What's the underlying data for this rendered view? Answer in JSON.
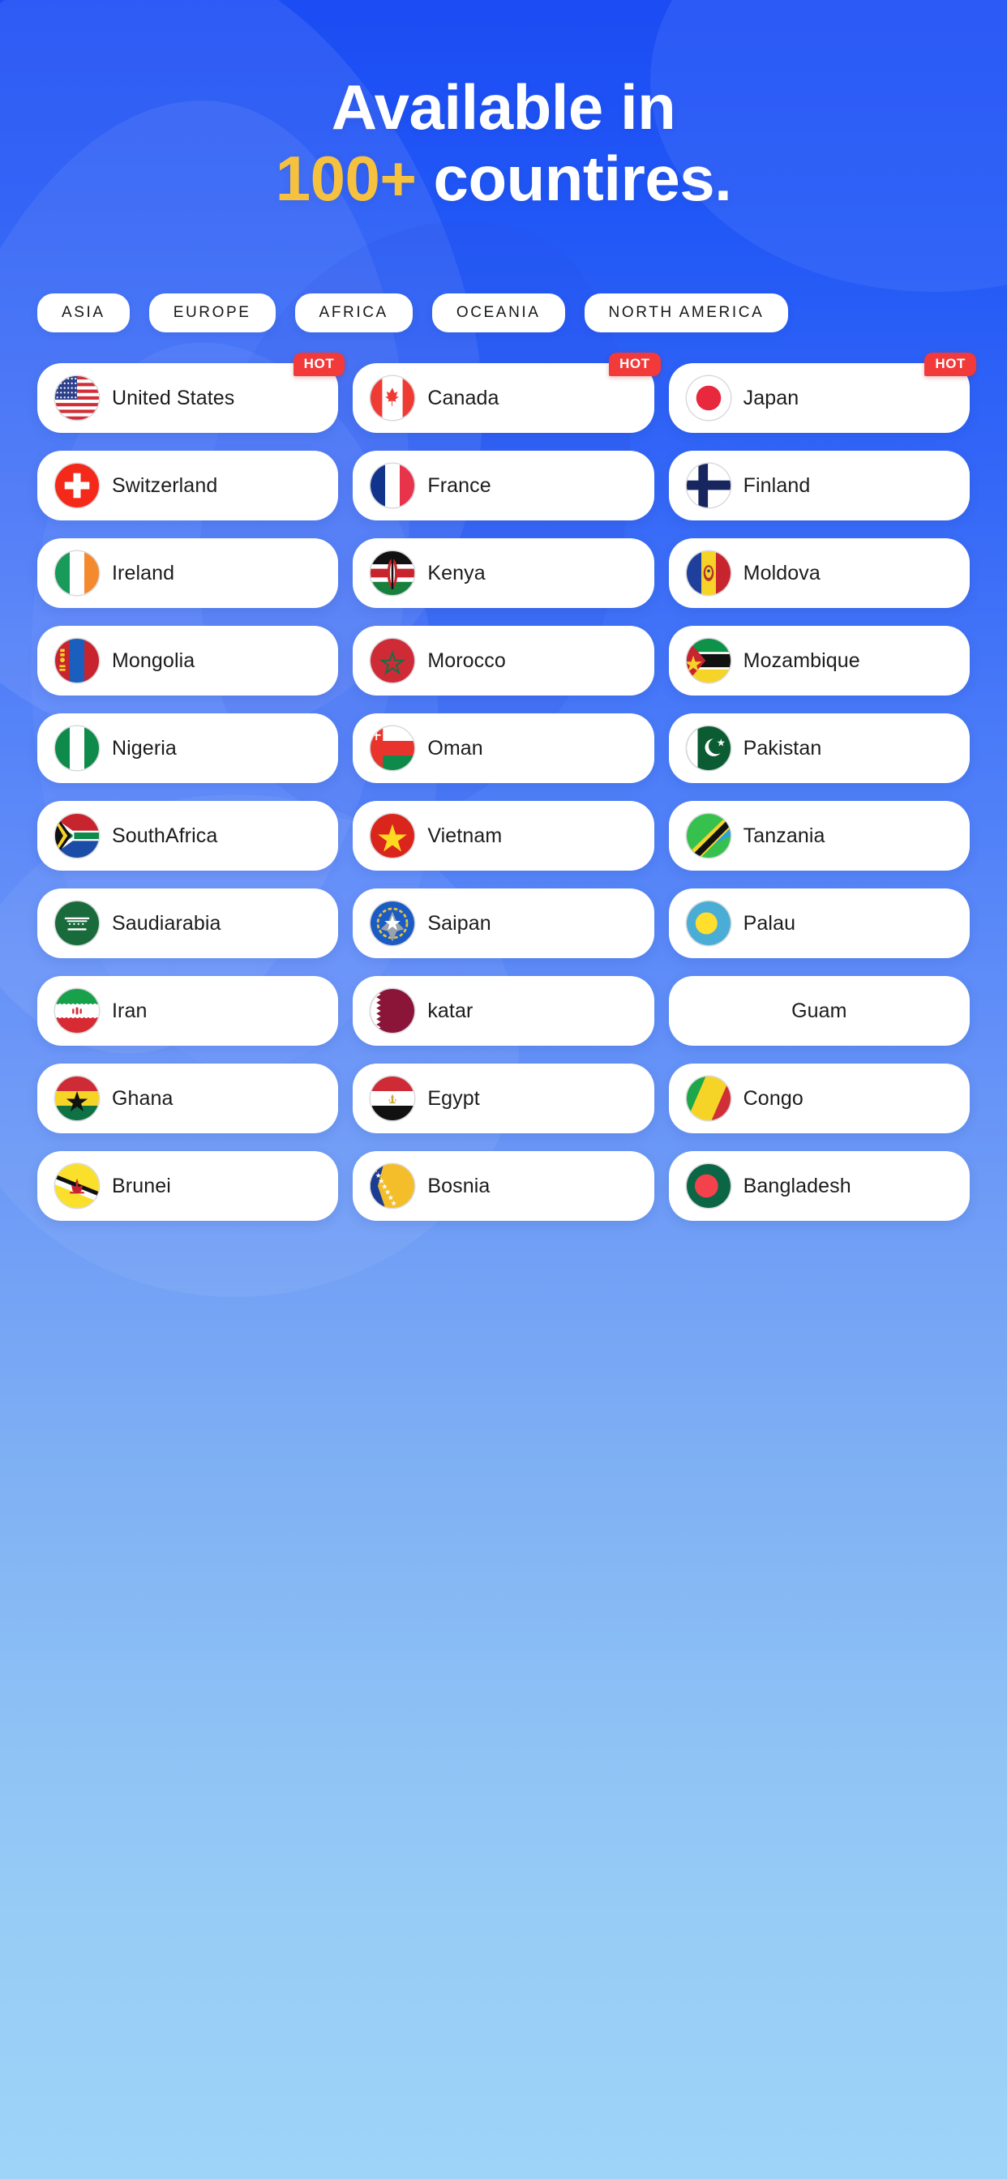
{
  "heading": {
    "line1": "Available in",
    "highlight": "100+",
    "line2_rest": " countires."
  },
  "colors": {
    "bg_top": "#1B4CF4",
    "bg_bottom": "#9ED4F8",
    "accent_yellow": "#F5C13F",
    "badge_red": "#F23A3A",
    "card_bg": "#FFFFFF",
    "text_dark": "#1C1C1C"
  },
  "tabs": [
    {
      "label": "ASIA"
    },
    {
      "label": "EUROPE"
    },
    {
      "label": "AFRICA"
    },
    {
      "label": "OCEANIA"
    },
    {
      "label": "NORTH AMERICA"
    }
  ],
  "badge_label": "HOT",
  "countries": [
    {
      "name": "United States",
      "flag": "flag-united-states",
      "badge": "HOT"
    },
    {
      "name": "Canada",
      "flag": "flag-canada",
      "badge": "HOT"
    },
    {
      "name": "Japan",
      "flag": "flag-japan",
      "badge": "HOT"
    },
    {
      "name": "Switzerland",
      "flag": "flag-switzerland",
      "badge": null
    },
    {
      "name": "France",
      "flag": "flag-france",
      "badge": null
    },
    {
      "name": "Finland",
      "flag": "flag-finland",
      "badge": null
    },
    {
      "name": "Ireland",
      "flag": "flag-ireland",
      "badge": null
    },
    {
      "name": "Kenya",
      "flag": "flag-kenya",
      "badge": null
    },
    {
      "name": "Moldova",
      "flag": "flag-moldova",
      "badge": null
    },
    {
      "name": "Mongolia",
      "flag": "flag-mongolia",
      "badge": null
    },
    {
      "name": "Morocco",
      "flag": "flag-morocco",
      "badge": null
    },
    {
      "name": "Mozambique",
      "flag": "flag-mozambique",
      "badge": null
    },
    {
      "name": "Nigeria",
      "flag": "flag-nigeria",
      "badge": null
    },
    {
      "name": "Oman",
      "flag": "flag-oman",
      "badge": null
    },
    {
      "name": "Pakistan",
      "flag": "flag-pakistan",
      "badge": null
    },
    {
      "name": "SouthAfrica",
      "flag": "flag-south-africa",
      "badge": null
    },
    {
      "name": "Vietnam",
      "flag": "flag-vietnam",
      "badge": null
    },
    {
      "name": "Tanzania",
      "flag": "flag-tanzania",
      "badge": null
    },
    {
      "name": "Saudiarabia",
      "flag": "flag-saudi-arabia",
      "badge": null
    },
    {
      "name": "Saipan",
      "flag": "flag-saipan",
      "badge": null
    },
    {
      "name": "Palau",
      "flag": "flag-palau",
      "badge": null
    },
    {
      "name": "Iran",
      "flag": "flag-iran",
      "badge": null
    },
    {
      "name": "katar",
      "flag": "flag-qatar",
      "badge": null
    },
    {
      "name": "Guam",
      "flag": null,
      "badge": null
    },
    {
      "name": "Ghana",
      "flag": "flag-ghana",
      "badge": null
    },
    {
      "name": "Egypt",
      "flag": "flag-egypt",
      "badge": null
    },
    {
      "name": "Congo",
      "flag": "flag-congo",
      "badge": null
    },
    {
      "name": "Brunei",
      "flag": "flag-brunei",
      "badge": null
    },
    {
      "name": "Bosnia",
      "flag": "flag-bosnia",
      "badge": null
    },
    {
      "name": "Bangladesh",
      "flag": "flag-bangladesh",
      "badge": null
    }
  ]
}
